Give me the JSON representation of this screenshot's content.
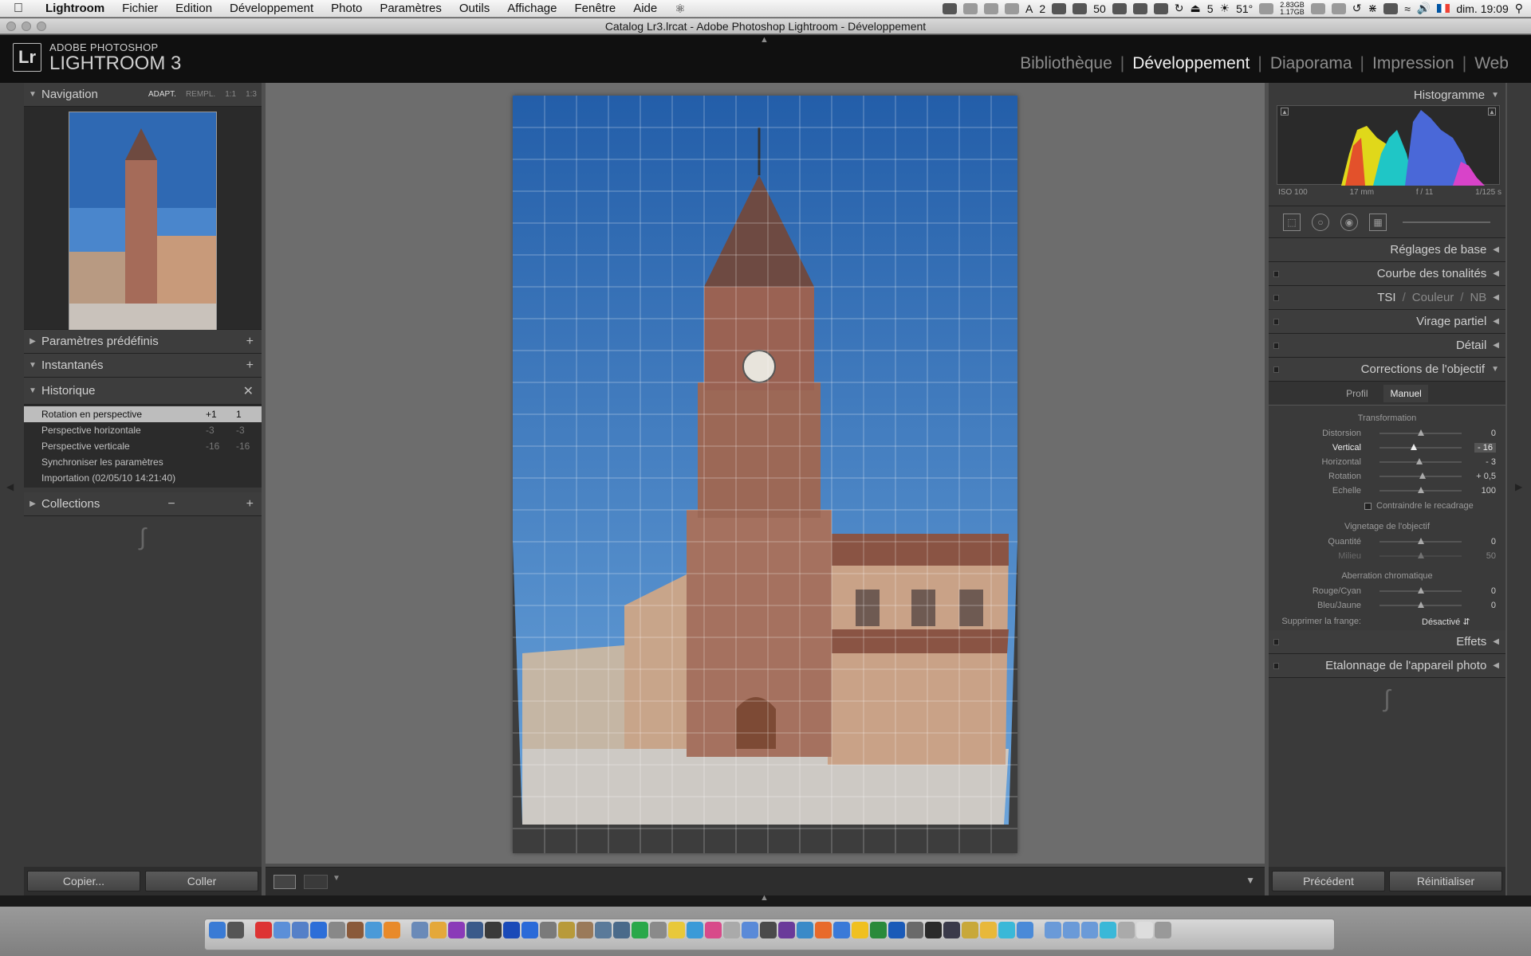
{
  "menubar": {
    "app_name": "Lightroom",
    "items": [
      "Fichier",
      "Edition",
      "Développement",
      "Photo",
      "Paramètres",
      "Outils",
      "Affichage",
      "Fenêtre",
      "Aide"
    ],
    "status": {
      "num1": "2",
      "num2": "50",
      "num3": "5",
      "temp": "51°",
      "disk1": "2.83GB",
      "disk2": "1.17GB",
      "clock": "dim. 19:09"
    }
  },
  "window": {
    "title": "Catalog Lr3.lrcat - Adobe Photoshop Lightroom - Développement"
  },
  "identity": {
    "logo": "Lr",
    "brand_small": "ADOBE PHOTOSHOP",
    "brand_big": "LIGHTROOM 3"
  },
  "modules": [
    {
      "label": "Bibliothèque",
      "active": false
    },
    {
      "label": "Développement",
      "active": true
    },
    {
      "label": "Diaporama",
      "active": false
    },
    {
      "label": "Impression",
      "active": false
    },
    {
      "label": "Web",
      "active": false
    }
  ],
  "left_panel": {
    "navigator": {
      "title": "Navigation",
      "zoom": [
        "ADAPT.",
        "REMPL.",
        "1:1",
        "1:3"
      ]
    },
    "presets": {
      "title": "Paramètres prédéfinis"
    },
    "snapshots": {
      "title": "Instantanés"
    },
    "history": {
      "title": "Historique",
      "items": [
        {
          "label": "Rotation en perspective",
          "v1": "+1",
          "v2": "1",
          "selected": true
        },
        {
          "label": "Perspective horizontale",
          "v1": "-3",
          "v2": "-3",
          "selected": false
        },
        {
          "label": "Perspective verticale",
          "v1": "-16",
          "v2": "-16",
          "selected": false
        },
        {
          "label": "Synchroniser les paramètres",
          "v1": "",
          "v2": "",
          "selected": false
        },
        {
          "label": "Importation (02/05/10 14:21:40)",
          "v1": "",
          "v2": "",
          "selected": false
        }
      ]
    },
    "collections": {
      "title": "Collections"
    },
    "copy_button": "Copier...",
    "paste_button": "Coller"
  },
  "right_panel": {
    "histogram": {
      "title": "Histogramme",
      "iso": "ISO 100",
      "focal": "17 mm",
      "aperture": "f / 11",
      "shutter": "1/125 s"
    },
    "panels": {
      "basic": "Réglages de base",
      "tone_curve": "Courbe des tonalités",
      "hsl": "TSI",
      "color": "Couleur",
      "bw": "NB",
      "split": "Virage partiel",
      "detail": "Détail",
      "lens": "Corrections de l'objectif",
      "effects": "Effets",
      "calibration": "Etalonnage de l'appareil photo"
    },
    "lens": {
      "tabs": [
        "Profil",
        "Manuel"
      ],
      "transform_title": "Transformation",
      "transform": [
        {
          "label": "Distorsion",
          "value": "0",
          "pos": 0.5
        },
        {
          "label": "Vertical",
          "value": "- 16",
          "pos": 0.42,
          "highlight": true
        },
        {
          "label": "Horizontal",
          "value": "- 3",
          "pos": 0.49
        },
        {
          "label": "Rotation",
          "value": "+ 0,5",
          "pos": 0.52
        },
        {
          "label": "Echelle",
          "value": "100",
          "pos": 0.5
        }
      ],
      "constrain": "Contraindre le recadrage",
      "vignette_title": "Vignetage de l'objectif",
      "vignette": [
        {
          "label": "Quantité",
          "value": "0",
          "pos": 0.5
        },
        {
          "label": "Milieu",
          "value": "50",
          "pos": 0.5,
          "dim": true
        }
      ],
      "ca_title": "Aberration chromatique",
      "ca": [
        {
          "label": "Rouge/Cyan",
          "value": "0",
          "pos": 0.5
        },
        {
          "label": "Bleu/Jaune",
          "value": "0",
          "pos": 0.5
        }
      ],
      "fringe_label": "Supprimer la frange:",
      "fringe_value": "Désactivé"
    },
    "previous_button": "Précédent",
    "reset_button": "Réinitialiser"
  },
  "colors": {
    "accent": "#f0f0f0",
    "panel": "#3a3a3a",
    "sky": "#3d78c0"
  }
}
